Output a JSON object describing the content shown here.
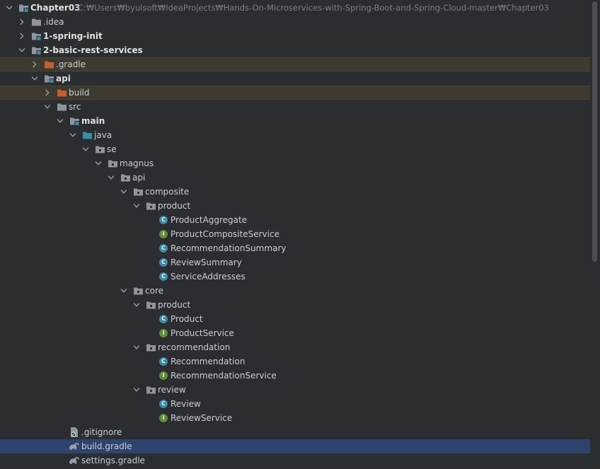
{
  "project_tree": {
    "root": {
      "name": "Chapter03",
      "path": "C:₩Users₩byulsoft₩IdeaProjects₩Hands-On-Microservices-with-Spring-Boot-and-Spring-Cloud-master₩Chapter03"
    },
    "nodes": [
      {
        "label": "Chapter03",
        "depth": 0,
        "expander": "expanded",
        "icon": "module-folder-icon",
        "bold": true,
        "highlight": "none"
      },
      {
        "label": ".idea",
        "depth": 1,
        "expander": "collapsed",
        "icon": "folder-icon",
        "bold": false,
        "highlight": "none"
      },
      {
        "label": "1-spring-init",
        "depth": 1,
        "expander": "collapsed",
        "icon": "module-folder-icon",
        "bold": true,
        "highlight": "none"
      },
      {
        "label": "2-basic-rest-services",
        "depth": 1,
        "expander": "expanded",
        "icon": "module-folder-icon",
        "bold": true,
        "highlight": "none"
      },
      {
        "label": ".gradle",
        "depth": 2,
        "expander": "collapsed",
        "icon": "excluded-folder-icon",
        "bold": false,
        "highlight": "excluded"
      },
      {
        "label": "api",
        "depth": 2,
        "expander": "expanded",
        "icon": "module-folder-icon",
        "bold": true,
        "highlight": "none"
      },
      {
        "label": "build",
        "depth": 3,
        "expander": "collapsed",
        "icon": "excluded-folder-icon",
        "bold": false,
        "highlight": "excluded"
      },
      {
        "label": "src",
        "depth": 3,
        "expander": "expanded",
        "icon": "folder-icon",
        "bold": false,
        "highlight": "none"
      },
      {
        "label": "main",
        "depth": 4,
        "expander": "expanded",
        "icon": "module-folder-icon",
        "bold": true,
        "highlight": "none"
      },
      {
        "label": "java",
        "depth": 5,
        "expander": "expanded",
        "icon": "source-root-folder-icon",
        "bold": false,
        "highlight": "none"
      },
      {
        "label": "se",
        "depth": 6,
        "expander": "expanded",
        "icon": "package-icon",
        "bold": false,
        "highlight": "none"
      },
      {
        "label": "magnus",
        "depth": 7,
        "expander": "expanded",
        "icon": "package-icon",
        "bold": false,
        "highlight": "none"
      },
      {
        "label": "api",
        "depth": 8,
        "expander": "expanded",
        "icon": "package-icon",
        "bold": false,
        "highlight": "none"
      },
      {
        "label": "composite",
        "depth": 9,
        "expander": "expanded",
        "icon": "package-icon",
        "bold": false,
        "highlight": "none"
      },
      {
        "label": "product",
        "depth": 10,
        "expander": "expanded",
        "icon": "package-icon",
        "bold": false,
        "highlight": "none"
      },
      {
        "label": "ProductAggregate",
        "depth": 11,
        "expander": "none",
        "icon": "class-icon",
        "bold": false,
        "highlight": "none"
      },
      {
        "label": "ProductCompositeService",
        "depth": 11,
        "expander": "none",
        "icon": "interface-icon",
        "bold": false,
        "highlight": "none"
      },
      {
        "label": "RecommendationSummary",
        "depth": 11,
        "expander": "none",
        "icon": "class-icon",
        "bold": false,
        "highlight": "none"
      },
      {
        "label": "ReviewSummary",
        "depth": 11,
        "expander": "none",
        "icon": "class-icon",
        "bold": false,
        "highlight": "none"
      },
      {
        "label": "ServiceAddresses",
        "depth": 11,
        "expander": "none",
        "icon": "class-icon",
        "bold": false,
        "highlight": "none"
      },
      {
        "label": "core",
        "depth": 9,
        "expander": "expanded",
        "icon": "package-icon",
        "bold": false,
        "highlight": "none"
      },
      {
        "label": "product",
        "depth": 10,
        "expander": "expanded",
        "icon": "package-icon",
        "bold": false,
        "highlight": "none"
      },
      {
        "label": "Product",
        "depth": 11,
        "expander": "none",
        "icon": "class-icon",
        "bold": false,
        "highlight": "none"
      },
      {
        "label": "ProductService",
        "depth": 11,
        "expander": "none",
        "icon": "interface-icon",
        "bold": false,
        "highlight": "none"
      },
      {
        "label": "recommendation",
        "depth": 10,
        "expander": "expanded",
        "icon": "package-icon",
        "bold": false,
        "highlight": "none"
      },
      {
        "label": "Recommendation",
        "depth": 11,
        "expander": "none",
        "icon": "class-icon",
        "bold": false,
        "highlight": "none"
      },
      {
        "label": "RecommendationService",
        "depth": 11,
        "expander": "none",
        "icon": "interface-icon",
        "bold": false,
        "highlight": "none"
      },
      {
        "label": "review",
        "depth": 10,
        "expander": "expanded",
        "icon": "package-icon",
        "bold": false,
        "highlight": "none"
      },
      {
        "label": "Review",
        "depth": 11,
        "expander": "none",
        "icon": "class-icon",
        "bold": false,
        "highlight": "none"
      },
      {
        "label": "ReviewService",
        "depth": 11,
        "expander": "none",
        "icon": "interface-icon",
        "bold": false,
        "highlight": "none"
      },
      {
        "label": ".gitignore",
        "depth": 4,
        "expander": "none",
        "icon": "gitignore-file-icon",
        "bold": false,
        "highlight": "none"
      },
      {
        "label": "build.gradle",
        "depth": 4,
        "expander": "none",
        "icon": "gradle-file-icon",
        "bold": false,
        "highlight": "selected"
      },
      {
        "label": "settings.gradle",
        "depth": 4,
        "expander": "none",
        "icon": "gradle-file-icon",
        "bold": false,
        "highlight": "none"
      }
    ]
  },
  "colors": {
    "background": "#2b2d30",
    "selected_row": "#2e436e",
    "excluded_row": "#3c3a31",
    "folder": "#8f959c",
    "excluded_folder": "#c4602d",
    "source_root_folder": "#3d8ca8",
    "class_badge": "#3e8aa6",
    "interface_badge": "#5f8e3a",
    "label_text": "#c9cdd3",
    "path_text": "#7b7e85"
  },
  "icons": {
    "class-icon": "C",
    "interface-icon": "I"
  }
}
